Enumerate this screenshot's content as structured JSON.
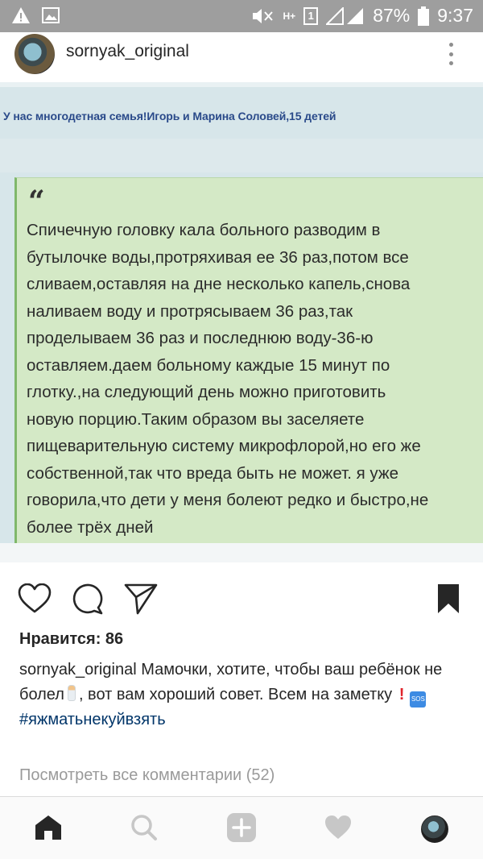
{
  "status_bar": {
    "battery": "87%",
    "time": "9:37",
    "network": "H+",
    "sim": "1",
    "icons": [
      "alert-icon",
      "image-icon",
      "mute-icon",
      "signal-icon",
      "battery-icon"
    ]
  },
  "post": {
    "username": "sornyak_original",
    "image": {
      "header_text": "У нас многодетная семья!Игорь и Марина Соловей,15 детей",
      "quote_mark": "“",
      "quote_lines": [
        "Спичечную головку кала больного разводим в",
        "бутылочке воды,протряхивая ее 36 раз,потом все",
        "сливаем,оставляя на дне несколько капель,снова",
        "наливаем воду и протрясываем 36 раз,так",
        "проделываем 36 раз и последнюю воду-36-ю",
        "оставляем.даем больному каждые 15 минут по",
        "глотку.,на следующий день можно приготовить",
        "новую порцию.Таким образом вы заселяете",
        "пищеварительную систему микрофлорой,но его же",
        "собственной,так что вреда быть не может. я уже",
        "говорила,что дети у меня болеют редко и быстро,не",
        "более трёх дней"
      ]
    },
    "likes": "Нравится: 86",
    "caption": {
      "username": "sornyak_original",
      "text_1": "Мамочки, хотите, чтобы ваш ребёнок не болел",
      "text_2": ", вот вам хороший совет. Всем на заметку",
      "sos_label": "SOS",
      "hashtag": "#яжматьнекуйвзять"
    },
    "view_comments": "Посмотреть все комментарии (52)"
  },
  "colors": {
    "status_bar": "#9e9e9e",
    "quote_bg": "#d4e9c6",
    "quote_border": "#7fb76a",
    "hashtag": "#003569",
    "muted": "#9a9a9a"
  }
}
